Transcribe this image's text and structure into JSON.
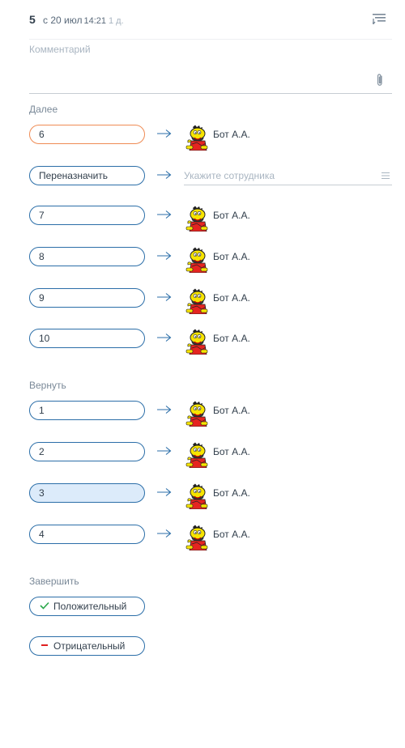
{
  "header": {
    "number": "5",
    "date": "с 20 июл",
    "time": "14:21",
    "ago": "1 д."
  },
  "comment": {
    "placeholder": "Комментарий"
  },
  "sections": {
    "next": "Далее",
    "return": "Вернуть",
    "finish": "Завершить"
  },
  "next_rows": [
    {
      "label": "6",
      "person": "Бот А.А.",
      "state": "active"
    },
    {
      "label": "Переназначить",
      "placeholder": "Укажите сотрудника"
    },
    {
      "label": "7",
      "person": "Бот А.А."
    },
    {
      "label": "8",
      "person": "Бот А.А."
    },
    {
      "label": "9",
      "person": "Бот А.А."
    },
    {
      "label": "10",
      "person": "Бот А.А."
    }
  ],
  "return_rows": [
    {
      "label": "1",
      "person": "Бот А.А."
    },
    {
      "label": "2",
      "person": "Бот А.А."
    },
    {
      "label": "3",
      "person": "Бот А.А.",
      "state": "selected"
    },
    {
      "label": "4",
      "person": "Бот А.А."
    }
  ],
  "finish_buttons": [
    {
      "label": "Положительный",
      "icon": "checkmark-icon",
      "icon_color": "#2aa84a"
    },
    {
      "label": "Отрицательный",
      "icon": "minus-icon",
      "icon_color": "#e02020"
    }
  ],
  "colors": {
    "accent": "#2b6ea8",
    "active_border": "#ef8b54",
    "selected_fill": "#dcebfa"
  }
}
